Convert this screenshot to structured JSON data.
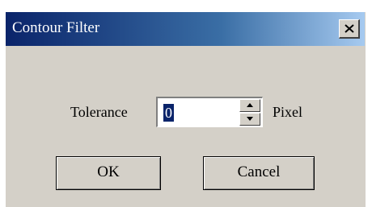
{
  "dialog": {
    "title": "Contour Filter",
    "close_icon": "close-icon",
    "tolerance_label": "Tolerance",
    "tolerance_value": "0",
    "unit_label": "Pixel",
    "ok_label": "OK",
    "cancel_label": "Cancel"
  },
  "colors": {
    "title_start": "#0a246a",
    "title_end": "#a6caf0",
    "face": "#d4d0c8"
  }
}
